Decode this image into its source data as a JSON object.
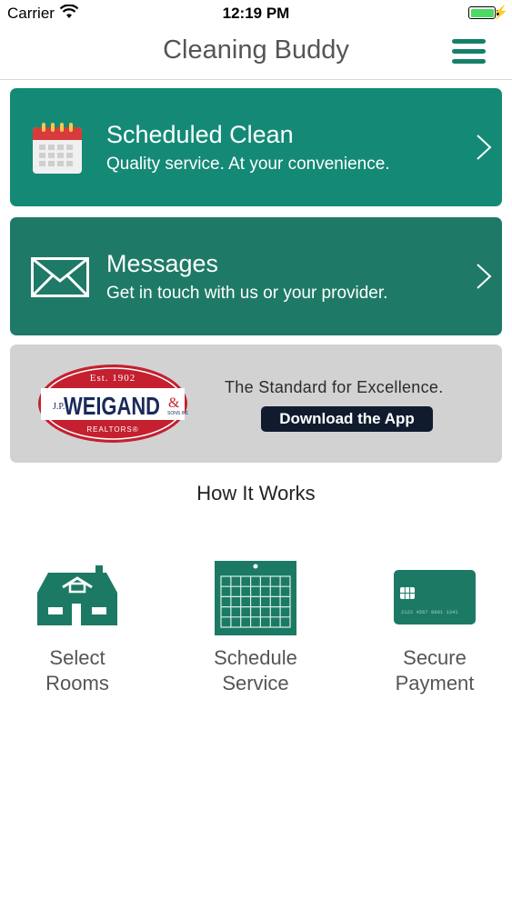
{
  "status_bar": {
    "carrier": "Carrier",
    "time": "12:19 PM",
    "battery_color": "#4cd964"
  },
  "nav": {
    "title": "Cleaning Buddy",
    "menu_icon": "hamburger-menu-icon",
    "accent": "#14806a"
  },
  "cards": [
    {
      "title": "Scheduled Clean",
      "subtitle": "Quality service. At your convenience.",
      "icon": "calendar-icon",
      "color": "#148a76"
    },
    {
      "title": "Messages",
      "subtitle": "Get in touch with us or your provider.",
      "icon": "envelope-icon",
      "color": "#1e7a66"
    }
  ],
  "ad": {
    "logo": {
      "est": "Est. 1902",
      "jp": "J.P.",
      "name": "WEIGAND",
      "amp": "&",
      "sons": "SONS INC.",
      "realtors": "REALTORS®"
    },
    "tagline": "The Standard for Excellence.",
    "button": "Download the App"
  },
  "how_it_works": {
    "heading": "How It Works",
    "steps": [
      {
        "line1": "Select",
        "line2": "Rooms",
        "icon": "house-icon"
      },
      {
        "line1": "Schedule",
        "line2": "Service",
        "icon": "calendar-grid-icon"
      },
      {
        "line1": "Secure",
        "line2": "Payment",
        "icon": "credit-card-icon"
      }
    ]
  }
}
